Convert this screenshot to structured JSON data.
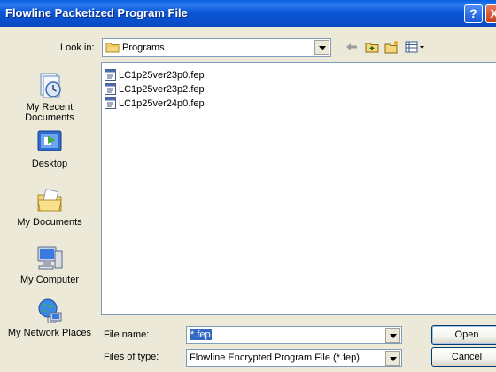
{
  "window": {
    "title": "Flowline Packetized Program File",
    "help_label": "?",
    "close_label": "X"
  },
  "lookin": {
    "label": "Look in:",
    "value": "Programs"
  },
  "toolbar": {
    "icons": [
      "back-icon",
      "up-folder-icon",
      "new-folder-icon",
      "views-menu-icon"
    ]
  },
  "places": [
    {
      "label": "My Recent Documents",
      "icon": "recent-documents-icon"
    },
    {
      "label": "Desktop",
      "icon": "desktop-icon"
    },
    {
      "label": "My Documents",
      "icon": "my-documents-icon"
    },
    {
      "label": "My Computer",
      "icon": "my-computer-icon"
    },
    {
      "label": "My Network Places",
      "icon": "network-places-icon"
    }
  ],
  "files": [
    {
      "name": "LC1p25ver23p0.fep"
    },
    {
      "name": "LC1p25ver23p2.fep"
    },
    {
      "name": "LC1p25ver24p0.fep"
    }
  ],
  "filename": {
    "label": "File name:",
    "value": "*.fep"
  },
  "filetype": {
    "label": "Files of type:",
    "value": "Flowline Encrypted Program File (*.fep)"
  },
  "buttons": {
    "open": "Open",
    "cancel": "Cancel"
  }
}
